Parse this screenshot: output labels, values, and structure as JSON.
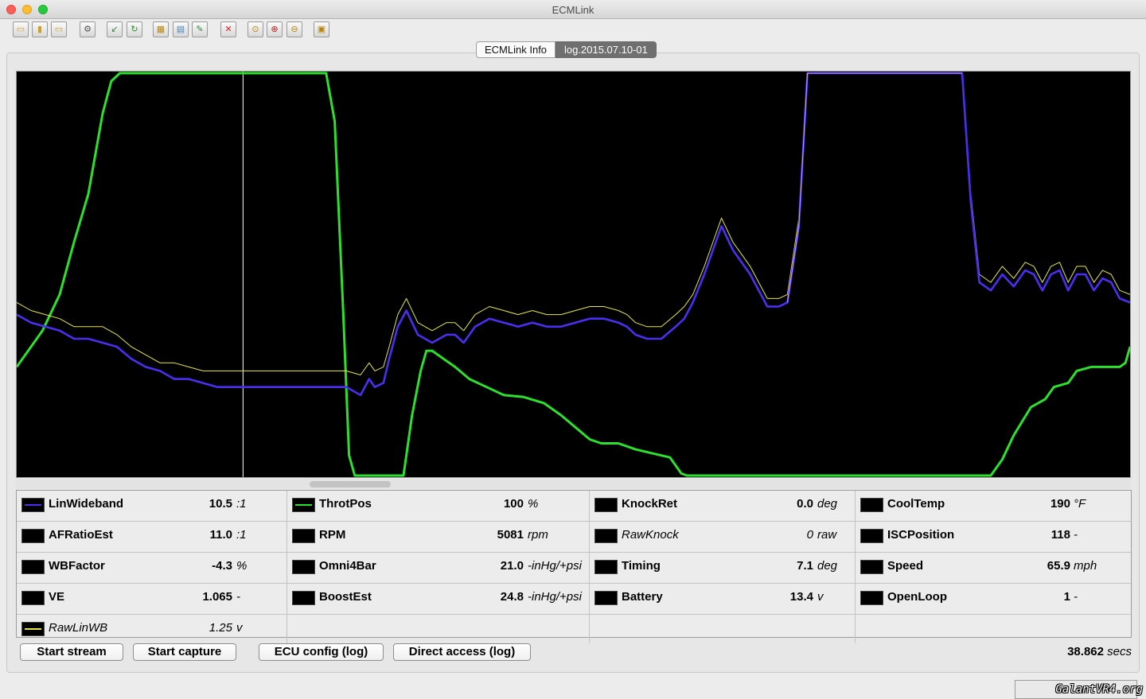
{
  "window": {
    "title": "ECMLink"
  },
  "toolbar": {
    "buttons": [
      {
        "name": "open-icon",
        "glyph": "▭",
        "color": "#c9a227"
      },
      {
        "name": "save-icon",
        "glyph": "▮",
        "color": "#c9a227"
      },
      {
        "name": "save-as-icon",
        "glyph": "▭",
        "color": "#c9a227"
      },
      {
        "name": "settings-icon",
        "glyph": "⚙",
        "color": "#555555"
      },
      {
        "name": "import-icon",
        "glyph": "↙",
        "color": "#2e8b2e"
      },
      {
        "name": "refresh-icon",
        "glyph": "↻",
        "color": "#2e8b2e"
      },
      {
        "name": "edit-map-icon",
        "glyph": "▦",
        "color": "#b8860b"
      },
      {
        "name": "compare-icon",
        "glyph": "▤",
        "color": "#4682b4"
      },
      {
        "name": "tools-icon",
        "glyph": "✎",
        "color": "#2e8b2e"
      },
      {
        "name": "delete-icon",
        "glyph": "✕",
        "color": "#e02020"
      },
      {
        "name": "zoom-fit-icon",
        "glyph": "⊙",
        "color": "#b8860b"
      },
      {
        "name": "zoom-in-icon",
        "glyph": "⊕",
        "color": "#c02020"
      },
      {
        "name": "zoom-out-icon",
        "glyph": "⊖",
        "color": "#b8860b"
      },
      {
        "name": "export-icon",
        "glyph": "▣",
        "color": "#b8860b"
      }
    ]
  },
  "tabs": [
    {
      "label": "ECMLink Info",
      "selected": false
    },
    {
      "label": "log.2015.07.10-01",
      "selected": true
    }
  ],
  "chart_data": {
    "type": "line",
    "title": "",
    "cursor_time": 7.9,
    "x_range": [
      0,
      38.862
    ],
    "y_range": [
      0,
      100
    ],
    "series": [
      {
        "name": "ThrotPos",
        "color": "#2ee02e",
        "x": [
          0,
          0.4,
          0.9,
          1.5,
          2.0,
          2.5,
          3.0,
          3.3,
          3.6,
          3.9,
          10.8,
          11.1,
          11.4,
          11.6,
          11.8,
          12.2,
          13.5,
          13.8,
          14.1,
          14.3,
          14.5,
          14.7,
          14.9,
          15.3,
          15.8,
          16.4,
          17.0,
          17.7,
          18.4,
          19.0,
          19.5,
          20.0,
          20.4,
          21.0,
          21.6,
          22.2,
          22.8,
          23.2,
          23.4,
          23.6,
          34.0,
          34.4,
          34.8,
          35.4,
          35.9,
          36.2,
          36.7,
          37.0,
          37.5,
          38.5,
          38.7,
          38.862
        ],
        "values": [
          27,
          31,
          36,
          45,
          58,
          70,
          90,
          98,
          100,
          100,
          100,
          88,
          40,
          5,
          0,
          0,
          0,
          15,
          26,
          31,
          31,
          30,
          29,
          27,
          24,
          22,
          20,
          19.5,
          18,
          15,
          12,
          9,
          8,
          8,
          6.5,
          5.5,
          4.5,
          0.5,
          0,
          0,
          0,
          4,
          10,
          17,
          19,
          22,
          23,
          26,
          27,
          27,
          28,
          32
        ]
      },
      {
        "name": "RawLinWB",
        "color": "#e6e64a",
        "x": [
          0,
          0.5,
          1.0,
          1.5,
          2.0,
          2.5,
          3.0,
          3.5,
          4.0,
          4.5,
          5.0,
          5.5,
          6.0,
          6.5,
          7.0,
          7.5,
          7.9,
          8.5,
          9.0,
          10.0,
          11.0,
          11.5,
          12.0,
          12.3,
          12.5,
          12.8,
          13.0,
          13.3,
          13.6,
          14.0,
          14.5,
          15.0,
          15.3,
          15.6,
          16.0,
          16.5,
          17.0,
          17.5,
          18.0,
          18.5,
          19.0,
          19.5,
          20.0,
          20.5,
          21.0,
          21.3,
          21.6,
          22.0,
          22.5,
          23.0,
          23.3,
          23.6,
          24.0,
          24.3,
          24.6,
          25.0,
          25.3,
          25.6,
          25.9,
          26.2,
          26.6,
          26.9,
          27.3,
          27.6,
          32.5,
          33.0,
          33.3,
          33.6,
          34.0,
          34.4,
          34.8,
          35.2,
          35.5,
          35.8,
          36.1,
          36.4,
          36.7,
          37.0,
          37.3,
          37.6,
          37.9,
          38.2,
          38.5,
          38.862
        ],
        "values": [
          43,
          41,
          40,
          39,
          37,
          37,
          37,
          35,
          32,
          30,
          28,
          28,
          27,
          26,
          26,
          26,
          26,
          26,
          26,
          26,
          26,
          26,
          25,
          28,
          26,
          27,
          32,
          40,
          44,
          38,
          36,
          38,
          38,
          36,
          40,
          42,
          41,
          40,
          41,
          40,
          40,
          41,
          42,
          42,
          41,
          40,
          38,
          37,
          37,
          40,
          42,
          45,
          52,
          58,
          64,
          58,
          55,
          52,
          48,
          44,
          44,
          45,
          64,
          100,
          100,
          100,
          70,
          50,
          48,
          52,
          49,
          53,
          52,
          48,
          52,
          53,
          48,
          52,
          52,
          48,
          51,
          50,
          46,
          45
        ]
      },
      {
        "name": "LinWideband",
        "color": "#4a2ff0",
        "x": [
          0,
          0.5,
          1.0,
          1.5,
          2.0,
          2.5,
          3.0,
          3.5,
          4.0,
          4.5,
          5.0,
          5.5,
          6.0,
          6.5,
          7.0,
          7.5,
          7.9,
          8.5,
          9.0,
          10.0,
          11.0,
          11.5,
          12.0,
          12.3,
          12.5,
          12.8,
          13.0,
          13.3,
          13.6,
          14.0,
          14.5,
          15.0,
          15.3,
          15.6,
          16.0,
          16.5,
          17.0,
          17.5,
          18.0,
          18.5,
          19.0,
          19.5,
          20.0,
          20.5,
          21.0,
          21.3,
          21.6,
          22.0,
          22.5,
          23.0,
          23.3,
          23.6,
          24.0,
          24.3,
          24.6,
          25.0,
          25.3,
          25.6,
          25.9,
          26.2,
          26.6,
          26.9,
          27.3,
          27.6,
          32.5,
          33.0,
          33.3,
          33.6,
          34.0,
          34.4,
          34.8,
          35.2,
          35.5,
          35.8,
          36.1,
          36.4,
          36.7,
          37.0,
          37.3,
          37.6,
          37.9,
          38.2,
          38.5,
          38.862
        ],
        "values": [
          40,
          38,
          37,
          36,
          34,
          34,
          33,
          32,
          29,
          27,
          26,
          24,
          24,
          23,
          22,
          22,
          22,
          22,
          22,
          22,
          22,
          22,
          20,
          24,
          22,
          23,
          29,
          37,
          41,
          35,
          33,
          35,
          35,
          33,
          37,
          39,
          38,
          37,
          38,
          37,
          37,
          38,
          39,
          39,
          38,
          37,
          35,
          34,
          34,
          37,
          39,
          43,
          50,
          56,
          62,
          56,
          53,
          50,
          46,
          42,
          42,
          43,
          62,
          100,
          100,
          100,
          68,
          48,
          46,
          50,
          47,
          51,
          50,
          46,
          50,
          51,
          46,
          50,
          50,
          46,
          49,
          48,
          44,
          43
        ]
      },
      {
        "name": "AFRatioEst",
        "color": "#c0a0e8",
        "x": [
          26.9,
          27.3,
          27.6,
          32.5,
          33.0
        ],
        "values": [
          43,
          62,
          100,
          100,
          100
        ]
      }
    ]
  },
  "params": {
    "col1": [
      {
        "name": "LinWideband",
        "value": "10.5",
        "unit": ":1",
        "swatch": "#4a2ff0",
        "italic": false
      },
      {
        "name": "AFRatioEst",
        "value": "11.0",
        "unit": ":1",
        "swatch": "",
        "italic": false
      },
      {
        "name": "WBFactor",
        "value": "-4.3",
        "unit": "%",
        "swatch": "",
        "italic": false
      },
      {
        "name": "VE",
        "value": "1.065",
        "unit": "-",
        "swatch": "",
        "italic": false
      },
      {
        "name": "RawLinWB",
        "value": "1.25",
        "unit": "v",
        "swatch": "#e6e64a",
        "italic": true
      }
    ],
    "col2": [
      {
        "name": "ThrotPos",
        "value": "100",
        "unit": "%",
        "swatch": "#2ee02e",
        "italic": false
      },
      {
        "name": "RPM",
        "value": "5081",
        "unit": "rpm",
        "swatch": "",
        "italic": false
      },
      {
        "name": "Omni4Bar",
        "value": "21.0",
        "unit": "-inHg/+psi",
        "swatch": "",
        "italic": false
      },
      {
        "name": "BoostEst",
        "value": "24.8",
        "unit": "-inHg/+psi",
        "swatch": "",
        "italic": false
      }
    ],
    "col3": [
      {
        "name": "KnockRet",
        "value": "0.0",
        "unit": "deg",
        "swatch": "",
        "italic": false
      },
      {
        "name": "RawKnock",
        "value": "0",
        "unit": "raw",
        "swatch": "",
        "italic": true
      },
      {
        "name": "Timing",
        "value": "7.1",
        "unit": "deg",
        "swatch": "",
        "italic": false
      },
      {
        "name": "Battery",
        "value": "13.4",
        "unit": "v",
        "swatch": "",
        "italic": false
      }
    ],
    "col4": [
      {
        "name": "CoolTemp",
        "value": "190",
        "unit": "°F",
        "swatch": "",
        "italic": false
      },
      {
        "name": "ISCPosition",
        "value": "118",
        "unit": "-",
        "swatch": "",
        "italic": false
      },
      {
        "name": "Speed",
        "value": "65.9",
        "unit": "mph",
        "swatch": "",
        "italic": false
      },
      {
        "name": "OpenLoop",
        "value": "1",
        "unit": "-",
        "swatch": "",
        "italic": false
      }
    ]
  },
  "buttons": {
    "start_stream": "Start stream",
    "start_capture": "Start capture",
    "ecu_config": "ECU config (log)",
    "direct_access": "Direct access (log)"
  },
  "status": {
    "time_value": "38.862",
    "time_unit": "secs"
  },
  "watermark": "GalantVR4.org"
}
